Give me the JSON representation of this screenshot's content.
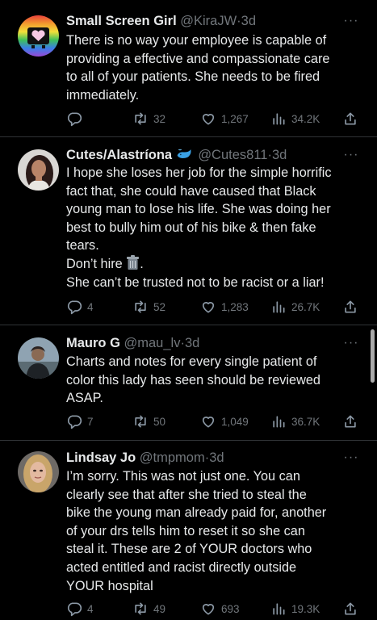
{
  "colors": {
    "background": "#000000",
    "text": "#e7e9ea",
    "muted": "#71767b",
    "divider": "#2f3336"
  },
  "icons": {
    "reply": "reply-icon",
    "retweet": "retweet-icon",
    "like": "heart-icon",
    "views": "views-icon",
    "share": "share-icon",
    "more": "more-icon",
    "name_emoji": "whale-icon",
    "inline_emoji": "trash-can-icon"
  },
  "tweets": [
    {
      "name": "Small Screen Girl",
      "handle": "@KiraJW",
      "separator": "·",
      "time": "3d",
      "more": "···",
      "lines": [
        "There is no way your employee is capable of",
        "providing a effective and compassionate care",
        "to all of your patients. She needs to be fired",
        "immediately."
      ],
      "replies": "",
      "retweets": "32",
      "likes": "1,267",
      "views": "34.2K"
    },
    {
      "name": "Cutes/Alastríona",
      "handle": "@Cutes811",
      "separator": "·",
      "time": "3d",
      "more": "···",
      "lines": [
        "I hope she loses her job for the simple horrific",
        "fact that, she could have caused that Black",
        "young man to lose his life. She was doing her",
        "best to bully him out of his bike & then fake",
        "tears.",
        "Don’t hire",
        "She can’t be trusted not to be racist or a liar!"
      ],
      "replies": "4",
      "retweets": "52",
      "likes": "1,283",
      "views": "26.7K"
    },
    {
      "name": "Mauro G",
      "handle": "@mau_lv",
      "separator": "·",
      "time": "3d",
      "more": "···",
      "lines": [
        "Charts and notes for every single patient of",
        "color this lady has seen should be reviewed",
        "ASAP."
      ],
      "replies": "7",
      "retweets": "50",
      "likes": "1,049",
      "views": "36.7K"
    },
    {
      "name": "Lindsay Jo",
      "handle": "@tmpmom",
      "separator": "·",
      "time": "3d",
      "more": "···",
      "lines": [
        "I’m sorry. This was not just one. You can",
        "clearly see that after she tried to steal the",
        "bike the young man already paid for, another",
        "of your drs tells him to reset it so she can",
        "steal it. These are 2 of YOUR doctors who",
        "acted entitled and racist directly outside",
        "YOUR hospital"
      ],
      "replies": "4",
      "retweets": "49",
      "likes": "693",
      "views": "19.3K"
    }
  ]
}
